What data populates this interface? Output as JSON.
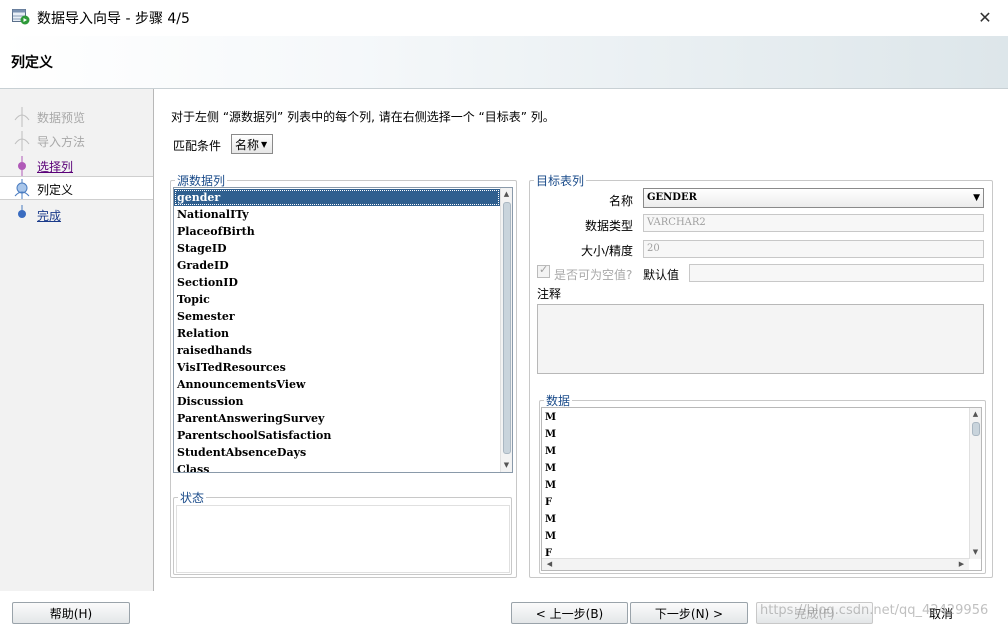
{
  "window": {
    "title": "数据导入向导 - 步骤 4/5",
    "close_glyph": "✕"
  },
  "header": {
    "title": "列定义"
  },
  "nav": {
    "items": [
      {
        "label": "数据预览",
        "state": "disabled"
      },
      {
        "label": "导入方法",
        "state": "disabled"
      },
      {
        "label": "选择列",
        "state": "visited"
      },
      {
        "label": "列定义",
        "state": "current"
      },
      {
        "label": "完成",
        "state": "link"
      }
    ]
  },
  "main": {
    "instruction": "对于左侧 “源数据列” 列表中的每个列, 请在右侧选择一个 “目标表” 列。",
    "match_label": "匹配条件",
    "match_value": "名称",
    "source_legend": "源数据列",
    "source_columns": [
      "gender",
      "NationalITy",
      "PlaceofBirth",
      "StageID",
      "GradeID",
      "SectionID",
      "Topic",
      "Semester",
      "Relation",
      "raisedhands",
      "VisITedResources",
      "AnnouncementsView",
      "Discussion",
      "ParentAnsweringSurvey",
      "ParentschoolSatisfaction",
      "StudentAbsenceDays",
      "Class"
    ],
    "selected_index": 0,
    "status_legend": "状态",
    "target_legend": "目标表列",
    "name_label": "名称",
    "name_value": "GENDER",
    "type_label": "数据类型",
    "type_value": "VARCHAR2",
    "size_label": "大小/精度",
    "size_value": "20",
    "nullable_label": "是否可为空值?",
    "default_label": "默认值",
    "default_value": "",
    "comment_label": "注释",
    "data_legend": "数据",
    "data_values": [
      "M",
      "M",
      "M",
      "M",
      "M",
      "F",
      "M",
      "M",
      "F"
    ]
  },
  "buttons": {
    "help": "帮助(H)",
    "back": "< 上一步(B)",
    "next": "下一步(N) >",
    "finish": "完成(F)",
    "cancel": "取消"
  },
  "watermark": "https://blog.csdn.net/qq_42429956"
}
